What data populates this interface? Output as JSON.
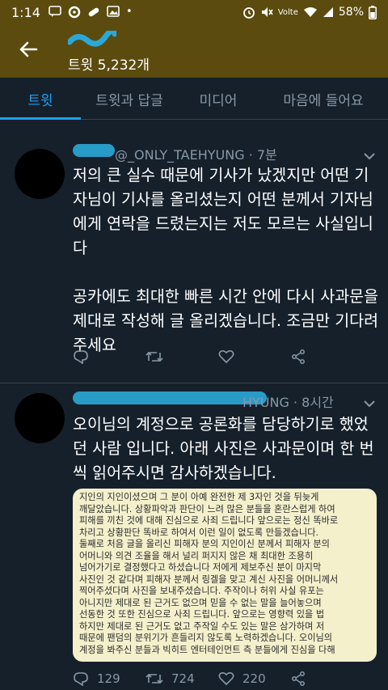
{
  "status_bar": {
    "time": "1:14",
    "battery": "58%",
    "network": "Volte"
  },
  "header": {
    "tweet_count": "트윗 5,232개"
  },
  "tabs": [
    {
      "label": "트윗",
      "active": true
    },
    {
      "label": "트윗과 답글",
      "active": false
    },
    {
      "label": "미디어",
      "active": false
    },
    {
      "label": "마음에 들어요",
      "active": false
    }
  ],
  "tweets": [
    {
      "handle": "@_ONLY_TAEHYUNG",
      "time": "· 7분",
      "paragraphs": [
        "저의 큰 실수 때문에 기사가 났겠지만 어떤 기자님이 기사를 올리셨는지 어떤 분께서 기자님에게 연락을 드렸는지는 저도 모르는 사실입니다",
        "공카에도 최대한 빠른 시간 안에 다시 사과문을 제대로 작성해 글 올리겠습니다. 조금만 기다려 주세요"
      ],
      "counts": {
        "replies": "",
        "retweets": "",
        "likes": ""
      }
    },
    {
      "handle": "HYUNG",
      "time": "· 8시간",
      "paragraphs": [
        "오이님의 계정으로 공론화를 담당하기로 했었던 사람 입니다. 아래 사진은 사과문이며 한 번씩 읽어주시면 감사하겠습니다."
      ],
      "counts": {
        "replies": "129",
        "retweets": "724",
        "likes": "220"
      }
    }
  ],
  "photo_text": [
    "지인의 지인이셨으며 그 분이 아예 완전한 제 3자인 것을 뒤늦게",
    "깨달았습니다. 상황파악과 판단이 느려 많은 분들을 혼란스럽게 하여",
    "피해를 끼친 것에 대해 진심으로 사죄 드립니다 앞으로는 정신 똑바로",
    "차리고 상황판단 똑바로 하여서 이런 일이 없도록 만들겠습니다.",
    "둘째로 처음 글을 올리신 피해자 분의 지인이신 분께서 피해자 분의",
    "어머니와 의견 조율을 해서 널리 퍼지지 않은 채 최대한 조용히",
    "넘어가기로 결정했다고 하셨습니다 저에게 제보주신 분이 마지막",
    "사진인 것 같다며 피해자 분께서 링겔을 맞고 계신 사진을 어머니께서",
    "찍어주셨다며 사진을 보내주셨습니다. 주작이나 허위 사실 유포는",
    "아니지만 제대로 된 근거도 없으며 믿을 수 없는 말을 늘어놓으며",
    "선동한 것 또한 진심으로 사죄 드립니다. 앞으로는 영향력 있을 법",
    "하지만 제대로 된 근거도 없고 주작일 수도 있는 말은 삼가하며 저",
    "때문에 팬덤의 분위기가 흔들리지 않도록 노력하겠습니다. 오이님의",
    "계정을 봐주신 분들과 빅히트 엔터테인먼트 측 분들에게 진심을 다해"
  ],
  "colors": {
    "status_bar_bg": "#5b4b0e",
    "background": "#15202b",
    "accent": "#1da1f2",
    "muted_text": "#8899a6",
    "photo_bg": "#f4f0cc"
  },
  "icons": [
    "back-arrow-icon",
    "reply-icon",
    "retweet-icon",
    "like-icon",
    "share-icon",
    "chevron-down-icon"
  ]
}
